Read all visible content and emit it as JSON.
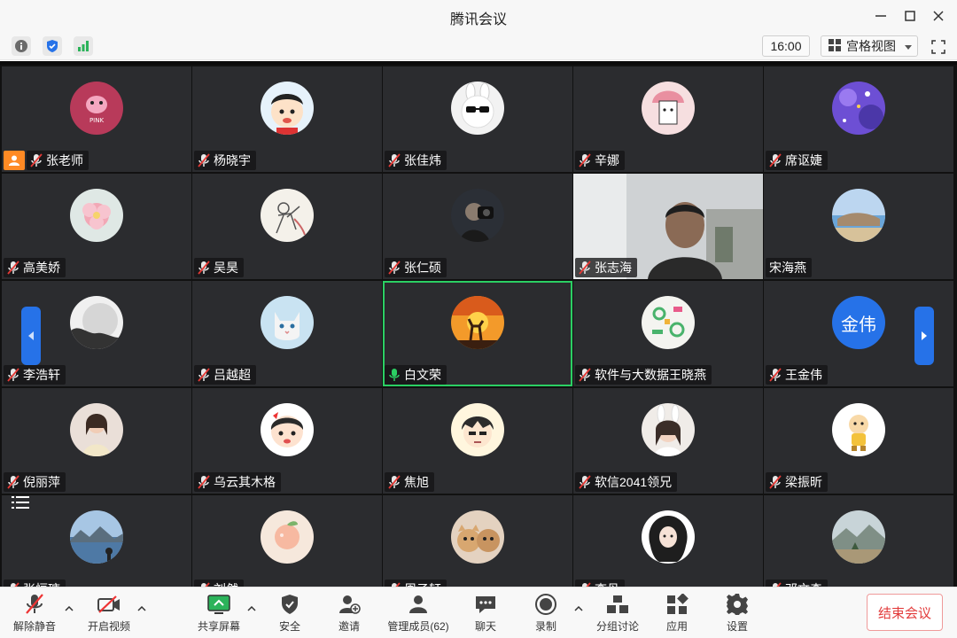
{
  "window": {
    "title": "腾讯会议"
  },
  "infobar": {
    "time": "16:00",
    "view_label": "宫格视图"
  },
  "colors": {
    "active_border": "#2bcf63",
    "accent_blue": "#2672e8",
    "host_orange": "#ff8a24",
    "end_red": "#e23b3b",
    "tile_bg": "#2b2c2f"
  },
  "participants": [
    {
      "name": "张老师",
      "mic": "muted",
      "host": true,
      "avatar": "pink-panther"
    },
    {
      "name": "杨晓宇",
      "mic": "muted",
      "avatar": "cartoon-boy"
    },
    {
      "name": "张佳炜",
      "mic": "muted",
      "avatar": "cool-bunny"
    },
    {
      "name": "辛娜",
      "mic": "muted",
      "avatar": "hat-character"
    },
    {
      "name": "席讴婕",
      "mic": "muted",
      "avatar": "purple-art"
    },
    {
      "name": "高美娇",
      "mic": "muted",
      "avatar": "flower"
    },
    {
      "name": "吴昊",
      "mic": "muted",
      "avatar": "sketch"
    },
    {
      "name": "张仁硕",
      "mic": "muted",
      "avatar": "photographer"
    },
    {
      "name": "张志海",
      "mic": "muted",
      "avatar": "camera-video"
    },
    {
      "name": "宋海燕",
      "mic": "none",
      "avatar": "seaside"
    },
    {
      "name": "李浩轩",
      "mic": "muted",
      "avatar": "moon"
    },
    {
      "name": "吕越超",
      "mic": "muted",
      "avatar": "white-cat"
    },
    {
      "name": "白文荣",
      "mic": "speaking",
      "active": true,
      "avatar": "sunset-deer"
    },
    {
      "name": "软件与大数据王晓燕",
      "mic": "muted",
      "avatar": "green-pattern"
    },
    {
      "name": "王金伟",
      "mic": "muted",
      "avatar": "text",
      "avatar_text": "金伟"
    },
    {
      "name": "倪丽萍",
      "mic": "muted",
      "avatar": "girl-photo"
    },
    {
      "name": "乌云其木格",
      "mic": "muted",
      "avatar": "cartoon-girl"
    },
    {
      "name": "焦旭",
      "mic": "muted",
      "avatar": "anime-boy"
    },
    {
      "name": "软信2041领兄",
      "mic": "muted",
      "avatar": "bunny-girl"
    },
    {
      "name": "梁振昕",
      "mic": "muted",
      "avatar": "little-bear"
    },
    {
      "name": "张恒瑭",
      "mic": "muted",
      "avatar": "lake"
    },
    {
      "name": "刘然",
      "mic": "muted",
      "avatar": "peach"
    },
    {
      "name": "周子轩",
      "mic": "muted",
      "avatar": "cats"
    },
    {
      "name": "李丹",
      "mic": "muted",
      "avatar": "curly-girl"
    },
    {
      "name": "邓文森",
      "mic": "muted",
      "avatar": "landscape"
    }
  ],
  "toolbar": {
    "unmute": "解除静音",
    "start_video": "开启视频",
    "share_screen": "共享屏幕",
    "security": "安全",
    "invite": "邀请",
    "members": "管理成员(62)",
    "chat": "聊天",
    "record": "录制",
    "breakout": "分组讨论",
    "apps": "应用",
    "settings": "设置",
    "end_meeting": "结束会议"
  }
}
